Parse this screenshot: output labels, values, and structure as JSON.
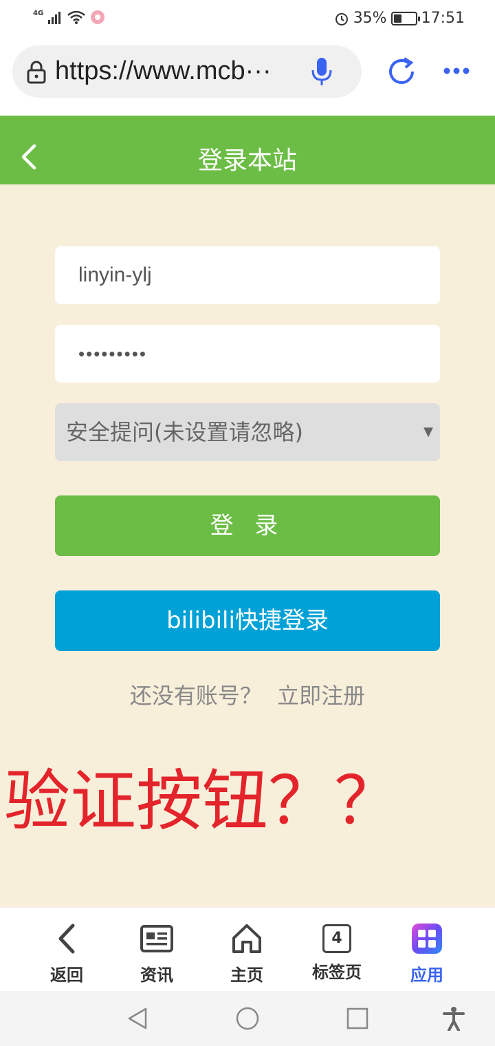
{
  "status_bar": {
    "network": "4G",
    "battery": "35%",
    "battery_level": 0.35,
    "time": "17:51"
  },
  "address_bar": {
    "url": "https://www.mcb···"
  },
  "header": {
    "title": "登录本站"
  },
  "form": {
    "username_value": "linyin-ylj",
    "password_mask": "•••••••••",
    "security_question": "安全提问(未设置请忽略)",
    "select_arrow": "▼",
    "login_label": "登 录",
    "bili_label": "bilibili快捷登录",
    "register_prompt": "还没有账号？",
    "register_link": "立即注册"
  },
  "annotation": "验证按钮？？",
  "bottom_nav": {
    "back": "返回",
    "news": "资讯",
    "home": "主页",
    "tabs": "标签页",
    "tab_count": "4",
    "apps": "应用"
  },
  "colors": {
    "green": "#6cbd45",
    "blue": "#00a1d6",
    "accent": "#3a63f1",
    "annotation": "#e3242b"
  }
}
